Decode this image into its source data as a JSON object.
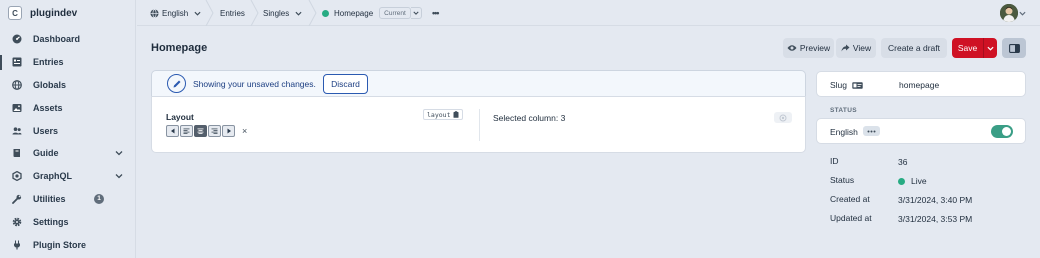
{
  "brand": {
    "letter": "C",
    "name": "plugindev"
  },
  "sidebar": {
    "items": [
      {
        "label": "Dashboard",
        "icon": "gauge-icon"
      },
      {
        "label": "Entries",
        "icon": "entries-icon",
        "selected": true
      },
      {
        "label": "Globals",
        "icon": "globe-icon"
      },
      {
        "label": "Assets",
        "icon": "image-icon"
      },
      {
        "label": "Users",
        "icon": "users-icon"
      },
      {
        "label": "Guide",
        "icon": "book-icon",
        "expandable": true
      },
      {
        "label": "GraphQL",
        "icon": "graphql-icon",
        "expandable": true
      },
      {
        "label": "Utilities",
        "icon": "wrench-icon",
        "badge": "1"
      },
      {
        "label": "Settings",
        "icon": "gear-icon"
      },
      {
        "label": "Plugin Store",
        "icon": "plug-icon"
      }
    ]
  },
  "topbar": {
    "site": "English",
    "section": "Entries",
    "type": "Singles",
    "entry": "Homepage",
    "current": "Current",
    "more": "•••"
  },
  "header": {
    "title": "Homepage",
    "preview": "Preview",
    "view": "View",
    "create_draft": "Create a draft",
    "save": "Save"
  },
  "notice": {
    "text": "Showing your unsaved changes.",
    "discard": "Discard"
  },
  "field": {
    "label": "Layout",
    "handle": "layout",
    "clear": "×",
    "selected_column": "Selected column: 3"
  },
  "meta": {
    "slug_label": "Slug",
    "slug_value": "homepage",
    "status_heading": "STATUS",
    "site_label": "English",
    "site_enabled": true,
    "id_label": "ID",
    "id_value": "36",
    "status_label": "Status",
    "status_value": "Live",
    "created_label": "Created at",
    "created_value": "3/31/2024, 3:40 PM",
    "updated_label": "Updated at",
    "updated_value": "3/31/2024, 3:53 PM"
  },
  "colors": {
    "accent": "#27ab83",
    "save": "#cf1124",
    "notice_blue": "#2b5ab1"
  }
}
